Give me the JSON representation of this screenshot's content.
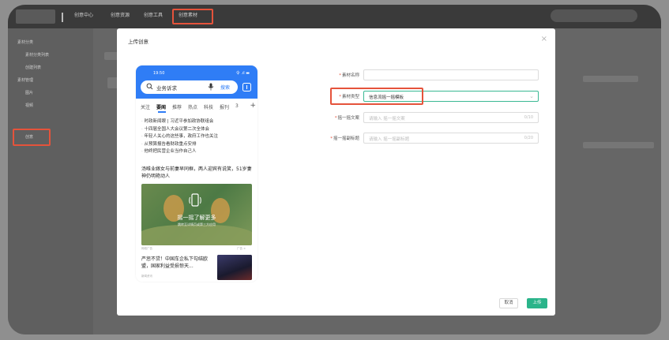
{
  "app": {
    "nav_center": "创意中心",
    "nav_items": [
      "创意资源",
      "创意工具",
      "创意素材"
    ]
  },
  "sidebar": {
    "items": [
      "素材分类",
      "素材分类列表",
      "创建列表",
      "素材管理",
      "图片",
      "视频",
      "创意"
    ]
  },
  "modal": {
    "title": "上传创意",
    "close": "×",
    "cancel_label": "取消",
    "upload_label": "上传"
  },
  "phone": {
    "time": "19:50",
    "status": "令 .ıl ▬",
    "search_placeholder": "业务诉求",
    "search_button": "搜索",
    "tabs": [
      "关注",
      "要闻",
      "推荐",
      "热点",
      "科技",
      "报刊",
      "3"
    ],
    "active_tab": "要闻",
    "news": [
      "时政新闻眼 | 习近平参加政协联组会",
      "十四届全国人大会议第二次全体会",
      "年轻人关心的这些事，政府工作也关注",
      "从预算报告看财政重点安排",
      "他终把民营企业当作自己人"
    ],
    "headline": "汤唯业嫁女与前妻早同框，两人迎宾有说笑，51岁妻神仍明艳动人",
    "ad_main": "摇一摇了解更多",
    "ad_sub": "跳转至详情页或第三方应用",
    "ad_tag": "网络广告",
    "ad_tag2": "广告 ×",
    "article2": "严惩不贷！中国车企私下勾结欧盟，国家利益受损惊天...",
    "article2_src": "新闻资讯"
  },
  "form": {
    "name_label": "素材名称",
    "name_value": "",
    "type_label": "素材类型",
    "type_value": "信息流摇一摇模板",
    "copy_label": "摇一摇文案",
    "copy_placeholder": "请输入 摇一摇文案",
    "copy_count": "0/10",
    "subtitle_label": "摇一摇副标题",
    "subtitle_placeholder": "请输入 摇一摇副标题",
    "subtitle_count": "0/20"
  },
  "colors": {
    "primary_blue": "#2f7df6",
    "confirm_green": "#2ab48a",
    "highlight_red": "#e5533b"
  }
}
